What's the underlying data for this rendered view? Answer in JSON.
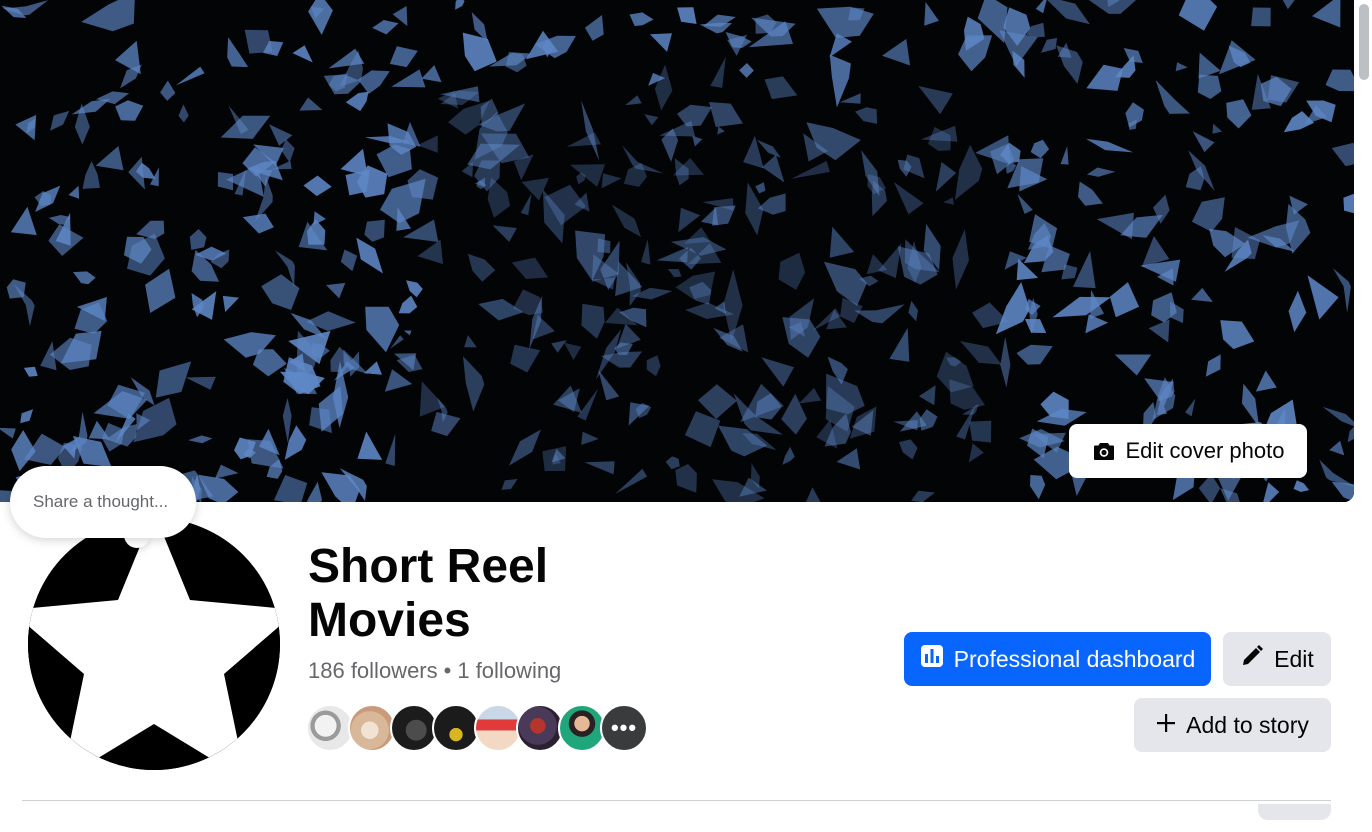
{
  "cover": {
    "edit_label": "Edit cover photo",
    "icon": "camera-icon",
    "colors": {
      "sky": "#6f9ee8",
      "foliage": "#030407"
    }
  },
  "thought_bubble": {
    "placeholder": "Share a thought..."
  },
  "profile": {
    "name": "Short Reel Movies",
    "followers": "186 followers",
    "separator": "•",
    "following": "1 following"
  },
  "follower_avatars": {
    "more_label": "•••"
  },
  "actions": {
    "professional_dashboard": {
      "label": "Professional dashboard",
      "icon": "chart-icon"
    },
    "edit": {
      "label": "Edit",
      "icon": "pencil-icon"
    },
    "add_to_story": {
      "label": "Add to story",
      "icon": "plus-icon"
    }
  },
  "colors": {
    "primary": "#0866ff",
    "secondary_button": "#e4e6eb",
    "text_secondary": "#65676b"
  }
}
